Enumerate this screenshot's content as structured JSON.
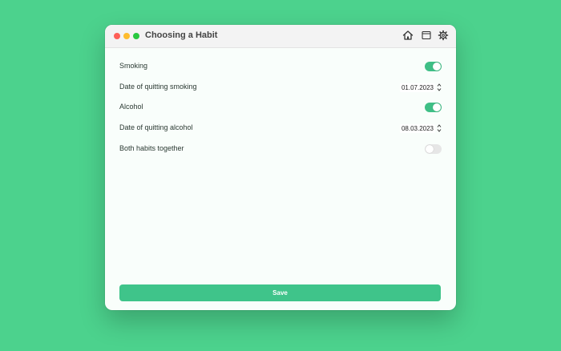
{
  "window": {
    "title": "Choosing a Habit"
  },
  "toolbar": {
    "icons": [
      "home-icon",
      "window-icon",
      "gear-icon"
    ]
  },
  "settings": {
    "smoking": {
      "label": "Smoking",
      "enabled": true
    },
    "smoking_date": {
      "label": "Date of quitting smoking",
      "value": "01.07.2023"
    },
    "alcohol": {
      "label": "Alcohol",
      "enabled": true
    },
    "alcohol_date": {
      "label": "Date of quitting alcohol",
      "value": "08.03.2023"
    },
    "both": {
      "label": "Both habits together",
      "enabled": false
    }
  },
  "actions": {
    "save_label": "Save"
  },
  "colors": {
    "background": "#4cd28d",
    "accent": "#3fc48a",
    "toggle_on": "#3fbf86",
    "toggle_off": "#e6e6e6"
  }
}
